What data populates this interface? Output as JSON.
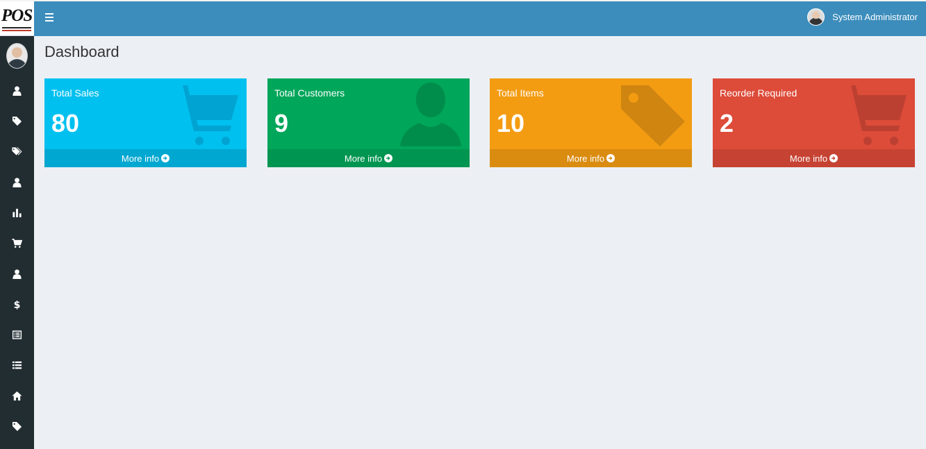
{
  "app": {
    "logo_text": "POS",
    "user_name": "System Administrator"
  },
  "page": {
    "title": "Dashboard"
  },
  "sidebar": {
    "items": [
      {
        "icon": "user-icon"
      },
      {
        "icon": "tag-icon"
      },
      {
        "icon": "tags-icon"
      },
      {
        "icon": "user-icon"
      },
      {
        "icon": "bar-chart-icon"
      },
      {
        "icon": "cart-icon"
      },
      {
        "icon": "user-icon"
      },
      {
        "icon": "dollar-icon"
      },
      {
        "icon": "list-alt-icon"
      },
      {
        "icon": "list-icon"
      },
      {
        "icon": "home-icon"
      },
      {
        "icon": "tag-icon"
      }
    ]
  },
  "boxes": [
    {
      "label": "Total Sales",
      "value": "80",
      "footer": "More info",
      "icon": "cart-icon",
      "color": "#00c0ef",
      "footer_color": "#00a7d0",
      "icon_color": "#00a3d1"
    },
    {
      "label": "Total Customers",
      "value": "9",
      "footer": "More info",
      "icon": "user-icon",
      "color": "#00a65a",
      "footer_color": "#009551",
      "icon_color": "#008d4c"
    },
    {
      "label": "Total Items",
      "value": "10",
      "footer": "More info",
      "icon": "tag-icon",
      "color": "#f39c12",
      "footer_color": "#da8c10",
      "icon_color": "#cf8510"
    },
    {
      "label": "Reorder Required",
      "value": "2",
      "footer": "More info",
      "icon": "cart-icon",
      "color": "#dd4b39",
      "footer_color": "#c64333",
      "icon_color": "#bc4031"
    }
  ]
}
